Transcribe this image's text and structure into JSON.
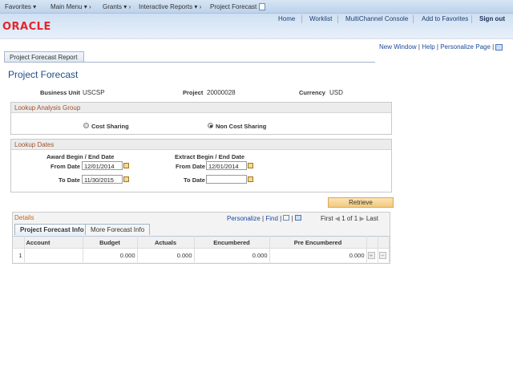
{
  "nav": {
    "favorites": "Favorites",
    "main_menu": "Main Menu",
    "grants": "Grants",
    "interactive_reports": "Interactive Reports",
    "current": "Project Forecast"
  },
  "header": {
    "logo": "ORACLE",
    "links": [
      "Home",
      "Worklist",
      "MultiChannel Console",
      "Add to Favorites",
      "Sign out"
    ]
  },
  "toolbar": {
    "new_window": "New Window",
    "help": "Help",
    "personalize": "Personalize Page"
  },
  "tab": "Project Forecast Report",
  "page_title": "Project Forecast",
  "info": {
    "bu_label": "Business Unit",
    "bu": "USCSP",
    "project_label": "Project",
    "project": "20000028",
    "currency_label": "Currency",
    "currency": "USD"
  },
  "analysis": {
    "title": "Lookup Analysis Group",
    "opt1": "Cost Sharing",
    "opt2": "Non Cost Sharing",
    "selected": "Non Cost Sharing"
  },
  "dates": {
    "title": "Lookup Dates",
    "award_title": "Award Begin / End Date",
    "extract_title": "Extract Begin / End Date",
    "from_label": "From Date",
    "to_label": "To Date",
    "award_from": "12/01/2014",
    "award_to": "11/30/2015",
    "extract_from": "12/01/2014",
    "extract_to": ""
  },
  "retrieve": "Retrieve",
  "details": {
    "title": "Details",
    "personalize": "Personalize",
    "find": "Find",
    "first": "First",
    "range": "1 of 1",
    "last": "Last",
    "tabs": [
      "Project Forecast Info",
      "More Forecast Info"
    ],
    "columns": [
      "Account",
      "Budget",
      "Actuals",
      "Encumbered",
      "Pre Encumbered"
    ],
    "rows": [
      {
        "num": "1",
        "account": "",
        "budget": "0.000",
        "actuals": "0.000",
        "encumbered": "0.000",
        "pre": "0.000"
      }
    ]
  }
}
